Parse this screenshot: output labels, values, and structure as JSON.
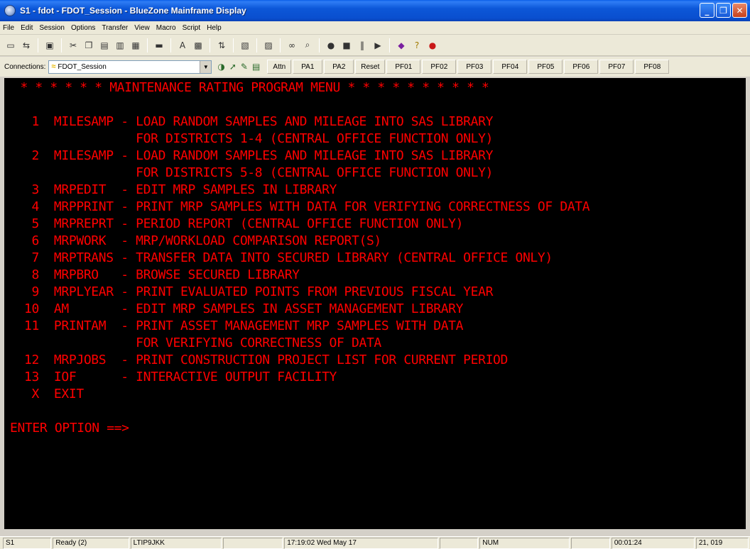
{
  "window": {
    "title": "S1 - fdot - FDOT_Session - BlueZone Mainframe Display",
    "minimize": "_",
    "restore": "❐",
    "close": "✕"
  },
  "menu": [
    "File",
    "Edit",
    "Session",
    "Options",
    "Transfer",
    "View",
    "Macro",
    "Script",
    "Help"
  ],
  "connection": {
    "label": "Connections:",
    "session": "FDOT_Session"
  },
  "keys": [
    "Attn",
    "PA1",
    "PA2",
    "Reset",
    "PF01",
    "PF02",
    "PF03",
    "PF04",
    "PF05",
    "PF06",
    "PF07",
    "PF08"
  ],
  "terminal": {
    "header": " * * * * * * MAINTENANCE RATING PROGRAM MENU * * * * * * * * * *",
    "lines": [
      " 1  MILESAMP - LOAD RANDOM SAMPLES AND MILEAGE INTO SAS LIBRARY",
      "               FOR DISTRICTS 1-4 (CENTRAL OFFICE FUNCTION ONLY)",
      " 2  MILESAMP - LOAD RANDOM SAMPLES AND MILEAGE INTO SAS LIBRARY",
      "               FOR DISTRICTS 5-8 (CENTRAL OFFICE FUNCTION ONLY)",
      " 3  MRPEDIT  - EDIT MRP SAMPLES IN LIBRARY",
      " 4  MRPPRINT - PRINT MRP SAMPLES WITH DATA FOR VERIFYING CORRECTNESS OF DATA",
      " 5  MRPREPRT - PERIOD REPORT (CENTRAL OFFICE FUNCTION ONLY)",
      " 6  MRPWORK  - MRP/WORKLOAD COMPARISON REPORT(S)",
      " 7  MRPTRANS - TRANSFER DATA INTO SECURED LIBRARY (CENTRAL OFFICE ONLY)",
      " 8  MRPBRO   - BROWSE SECURED LIBRARY",
      " 9  MRPLYEAR - PRINT EVALUATED POINTS FROM PREVIOUS FISCAL YEAR",
      "10  AM       - EDIT MRP SAMPLES IN ASSET MANAGEMENT LIBRARY",
      "11  PRINTAM  - PRINT ASSET MANAGEMENT MRP SAMPLES WITH DATA",
      "               FOR VERIFYING CORRECTNESS OF DATA",
      "12  MRPJOBS  - PRINT CONSTRUCTION PROJECT LIST FOR CURRENT PERIOD",
      "13  IOF      - INTERACTIVE OUTPUT FACILITY",
      " X  EXIT"
    ],
    "prompt": "ENTER OPTION ==>",
    "text_color": "#ff0000"
  },
  "status": {
    "session": "S1",
    "state": "Ready (2)",
    "lu": "LTIP9JKK",
    "datetime": "17:19:02 Wed May 17",
    "num": "NUM",
    "elapsed": "00:01:24",
    "cursor": "21, 019"
  }
}
